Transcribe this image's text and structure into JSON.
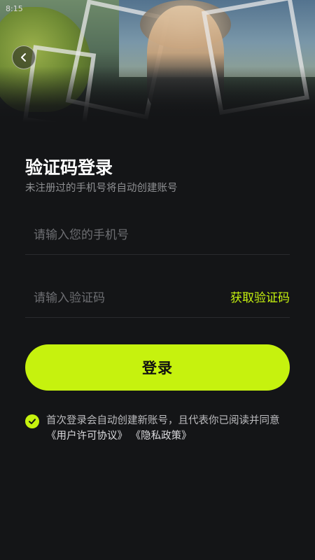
{
  "status_bar": {
    "time": "8:15"
  },
  "header": {
    "back_label": "‹"
  },
  "login": {
    "title": "验证码登录",
    "subtitle": "未注册过的手机号将自动创建账号",
    "phone_placeholder": "请输入您的手机号",
    "code_placeholder": "请输入验证码",
    "get_code_label": "获取验证码",
    "submit_label": "登录"
  },
  "agreement": {
    "checked": true,
    "text": "首次登录会自动创建新账号，且代表你已阅读并同意",
    "user_agreement": "《用户许可协议》",
    "privacy_policy": "《隐私政策》"
  },
  "colors": {
    "background": "#141517",
    "accent": "#c6f20e",
    "text_primary": "#ffffff",
    "text_secondary": "#8e8f92"
  }
}
